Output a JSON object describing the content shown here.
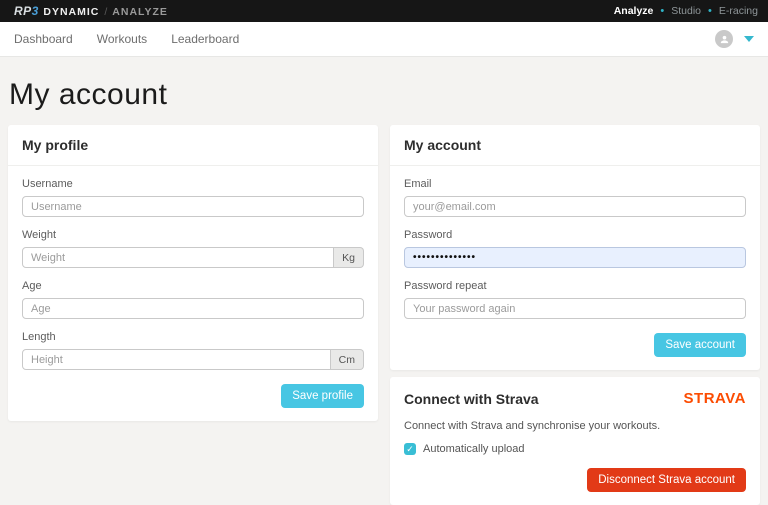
{
  "topbar": {
    "logo": {
      "rp": "RP",
      "three": "3",
      "dynamic": "DYNAMIC",
      "separator": "/",
      "analyze": "ANALYZE"
    },
    "bullet": "•",
    "products": [
      {
        "label": "Analyze",
        "active": true
      },
      {
        "label": "Studio",
        "active": false
      },
      {
        "label": "E-racing",
        "active": false
      }
    ]
  },
  "nav": {
    "items": [
      {
        "label": "Dashboard"
      },
      {
        "label": "Workouts"
      },
      {
        "label": "Leaderboard"
      }
    ]
  },
  "page": {
    "title": "My account"
  },
  "profile_card": {
    "title": "My profile",
    "username_label": "Username",
    "username_placeholder": "Username",
    "weight_label": "Weight",
    "weight_placeholder": "Weight",
    "weight_unit": "Kg",
    "age_label": "Age",
    "age_placeholder": "Age",
    "length_label": "Length",
    "length_placeholder": "Height",
    "length_unit": "Cm",
    "save_label": "Save profile"
  },
  "account_card": {
    "title": "My account",
    "email_label": "Email",
    "email_placeholder": "your@email.com",
    "password_label": "Password",
    "password_value": "••••••••••••••",
    "password_repeat_label": "Password repeat",
    "password_repeat_placeholder": "Your password again",
    "save_label": "Save account"
  },
  "strava_card": {
    "title": "Connect with Strava",
    "logo_text": "STRAVA",
    "description": "Connect with Strava and synchronise your workouts.",
    "checkbox_checked": true,
    "checkbox_glyph": "✓",
    "checkbox_label": "Automatically upload",
    "disconnect_label": "Disconnect Strava account"
  },
  "colors": {
    "accent_cyan": "#47c6e3",
    "teal_bullet": "#2fb4c7",
    "strava_orange": "#fc4c02",
    "danger_red": "#e23a17",
    "autofill_blue": "#e8f0fe"
  }
}
